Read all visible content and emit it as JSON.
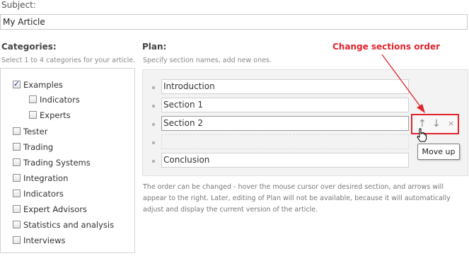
{
  "subject": {
    "label": "Subject:",
    "value": "My Article"
  },
  "categories": {
    "title": "Categories:",
    "hint": "Select 1 to 4 categories for your article.",
    "items": [
      {
        "label": "Examples",
        "checked": true,
        "level": 0
      },
      {
        "label": "Indicators",
        "checked": false,
        "level": 1
      },
      {
        "label": "Experts",
        "checked": false,
        "level": 1
      },
      {
        "label": "Tester",
        "checked": false,
        "level": 0
      },
      {
        "label": "Trading",
        "checked": false,
        "level": 0
      },
      {
        "label": "Trading Systems",
        "checked": false,
        "level": 0
      },
      {
        "label": "Integration",
        "checked": false,
        "level": 0
      },
      {
        "label": "Indicators",
        "checked": false,
        "level": 0
      },
      {
        "label": "Expert Advisors",
        "checked": false,
        "level": 0
      },
      {
        "label": "Statistics and analysis",
        "checked": false,
        "level": 0
      },
      {
        "label": "Interviews",
        "checked": false,
        "level": 0
      }
    ]
  },
  "plan": {
    "title": "Plan:",
    "hint": "Specify section names, add new ones.",
    "sections": [
      "Introduction",
      "Section 1",
      "Section 2",
      "",
      "Conclusion"
    ],
    "controls": {
      "up": "↑",
      "down": "↓",
      "remove": "×"
    },
    "tooltip": "Move up",
    "description": "The order can be changed - hover the mouse cursor over desired section, and arrows will appear to the right. Later, editing of Plan will not be available, because it will automatically adjust and display the current version of the article."
  },
  "annotation": {
    "text": "Change sections order",
    "color": "#e0242c"
  },
  "icons": {
    "cursor": "hand-pointer-icon",
    "arrow": "annotation-arrow"
  }
}
